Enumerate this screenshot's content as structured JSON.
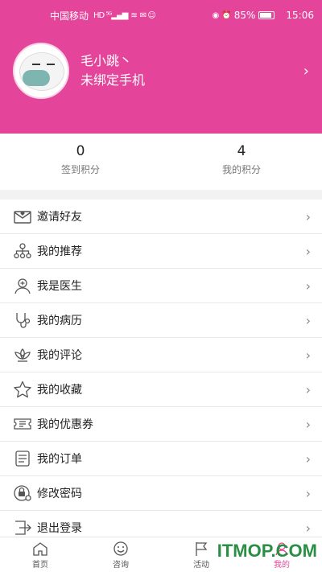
{
  "status_bar": {
    "carrier": "中国移动",
    "battery": "85%",
    "time": "15:06"
  },
  "profile": {
    "name": "毛小跳丶",
    "phone": "未绑定手机"
  },
  "stats": [
    {
      "value": "0",
      "label": "签到积分"
    },
    {
      "value": "4",
      "label": "我的积分"
    }
  ],
  "menu": [
    {
      "label": "邀请好友",
      "icon": "envelope-heart-icon"
    },
    {
      "label": "我的推荐",
      "icon": "network-icon"
    },
    {
      "label": "我是医生",
      "icon": "doctor-icon"
    },
    {
      "label": "我的病历",
      "icon": "stethoscope-icon"
    },
    {
      "label": "我的评论",
      "icon": "lotus-icon"
    },
    {
      "label": "我的收藏",
      "icon": "star-icon"
    },
    {
      "label": "我的优惠券",
      "icon": "ticket-icon"
    },
    {
      "label": "我的订单",
      "icon": "document-icon"
    },
    {
      "label": "修改密码",
      "icon": "lock-gear-icon"
    },
    {
      "label": "退出登录",
      "icon": "logout-icon"
    }
  ],
  "tabs": [
    {
      "label": "首页",
      "icon": "home-icon"
    },
    {
      "label": "咨询",
      "icon": "smile-icon"
    },
    {
      "label": "活动",
      "icon": "flag-icon"
    },
    {
      "label": "我的",
      "icon": "user-icon"
    }
  ],
  "watermark": "ITMOP.COM",
  "colors": {
    "accent": "#e4449a"
  }
}
